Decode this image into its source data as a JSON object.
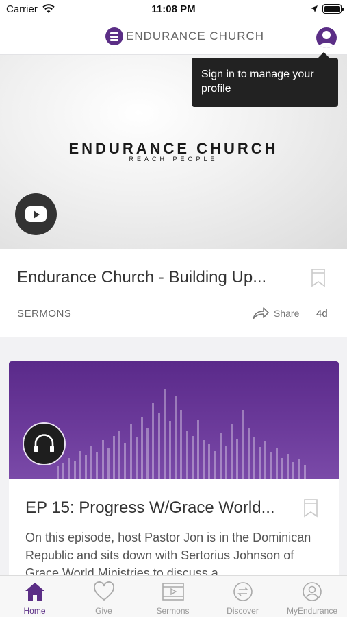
{
  "status_bar": {
    "carrier": "Carrier",
    "time": "11:08 PM"
  },
  "header": {
    "brand": "ENDURANCE CHURCH"
  },
  "tooltip": {
    "text": "Sign in to manage your profile"
  },
  "feed": [
    {
      "hero_title": "ENDURANCE CHURCH",
      "hero_subtitle": "REACH PEOPLE",
      "title": "Endurance Church - Building Up...",
      "category": "SERMONS",
      "share_label": "Share",
      "age": "4d",
      "media_icon": "youtube-icon"
    },
    {
      "title": "EP 15: Progress W/Grace World...",
      "description": "On this episode, host Pastor Jon is in the Dominican Republic and sits down with Sertorius Johnson of Grace World Ministries to discuss a",
      "media_icon": "headphones-icon"
    }
  ],
  "tabs": [
    {
      "label": "Home",
      "icon": "home-icon",
      "active": true
    },
    {
      "label": "Give",
      "icon": "heart-icon",
      "active": false
    },
    {
      "label": "Sermons",
      "icon": "film-icon",
      "active": false
    },
    {
      "label": "Discover",
      "icon": "discover-icon",
      "active": false
    },
    {
      "label": "MyEndurance",
      "icon": "person-icon",
      "active": false
    }
  ],
  "colors": {
    "accent": "#5b2e86",
    "tooltip_bg": "#222222",
    "podcast_bg": "#6b3a9a"
  }
}
